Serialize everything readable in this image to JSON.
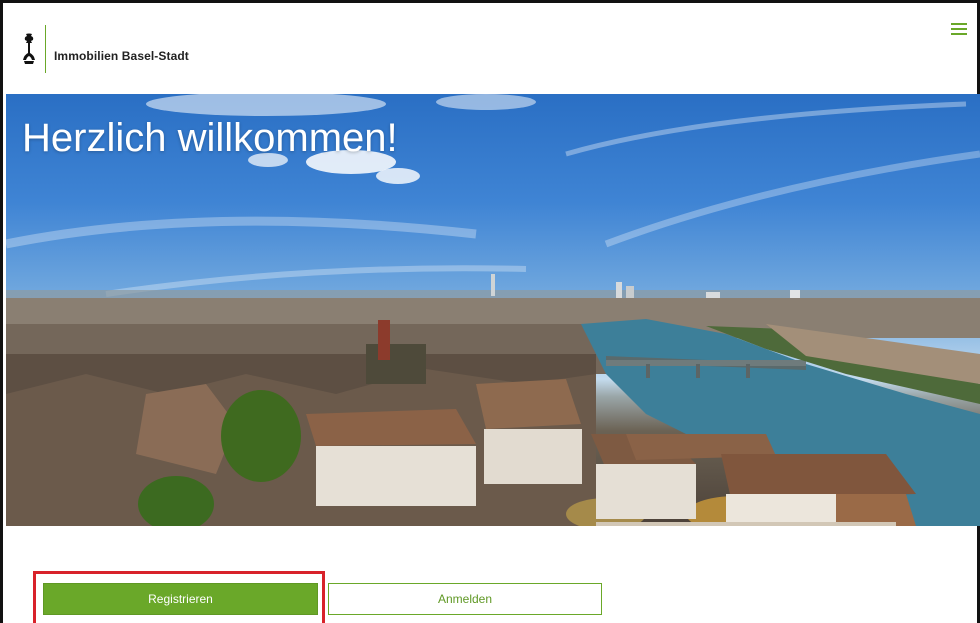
{
  "header": {
    "brand": "Immobilien Basel-Stadt",
    "menu_icon": "hamburger-menu-icon",
    "logo_icon": "baselstab-icon"
  },
  "hero": {
    "title": "Herzlich willkommen!"
  },
  "actions": {
    "register_label": "Registrieren",
    "login_label": "Anmelden"
  },
  "colors": {
    "brand_green": "#6aa829",
    "highlight_red": "#d8222a",
    "text_dark": "#222222"
  }
}
